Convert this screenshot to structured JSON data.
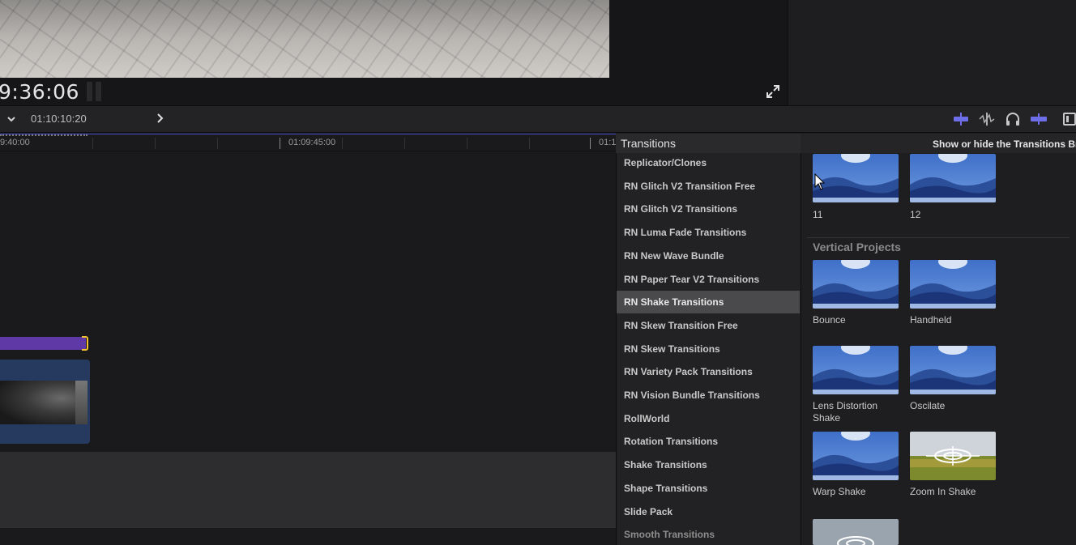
{
  "viewer": {
    "timecode": "9:36:06"
  },
  "timeline_toolbar": {
    "timecode": "01:10:10:20"
  },
  "ruler": {
    "labels": [
      "9:40:00",
      "01:09:45:00",
      "01:1"
    ]
  },
  "browser": {
    "title": "Transitions",
    "tooltip": "Show or hide the Transitions Br",
    "categories": [
      {
        "label": "Replicator/Clones"
      },
      {
        "label": "RN Glitch V2 Transition Free"
      },
      {
        "label": "RN Glitch V2 Transitions"
      },
      {
        "label": "RN Luma Fade Transitions"
      },
      {
        "label": "RN New Wave Bundle"
      },
      {
        "label": "RN Paper Tear V2 Transitions"
      },
      {
        "label": "RN Shake Transitions",
        "selected": true
      },
      {
        "label": "RN Skew Transition Free"
      },
      {
        "label": "RN Skew Transitions"
      },
      {
        "label": "RN Variety Pack Transitions"
      },
      {
        "label": "RN Vision Bundle Transitions"
      },
      {
        "label": "RollWorld"
      },
      {
        "label": "Rotation Transitions"
      },
      {
        "label": "Shake Transitions"
      },
      {
        "label": "Shape Transitions"
      },
      {
        "label": "Slide Pack"
      },
      {
        "label": "Smooth Transitions"
      }
    ],
    "top_items": [
      {
        "label": "11"
      },
      {
        "label": "12"
      }
    ],
    "section_title": "Vertical Projects",
    "items": [
      {
        "label": "Bounce",
        "icon": "mountain-thumbnail"
      },
      {
        "label": "Handheld",
        "icon": "mountain-thumbnail"
      },
      {
        "label": "Lens Distortion Shake",
        "icon": "mountain-thumbnail"
      },
      {
        "label": "Oscilate",
        "icon": "mountain-thumbnail"
      },
      {
        "label": "Warp Shake",
        "icon": "mountain-thumbnail"
      },
      {
        "label": "Zoom In Shake",
        "icon": "target-field-thumbnail"
      }
    ]
  },
  "colors": {
    "selection": "#4a4a4c",
    "timeline_accent": "#4c4cc4",
    "title_clip": "#5f3aa6",
    "clip_handle": "#f2c030",
    "video_clip": "#253a5e"
  }
}
